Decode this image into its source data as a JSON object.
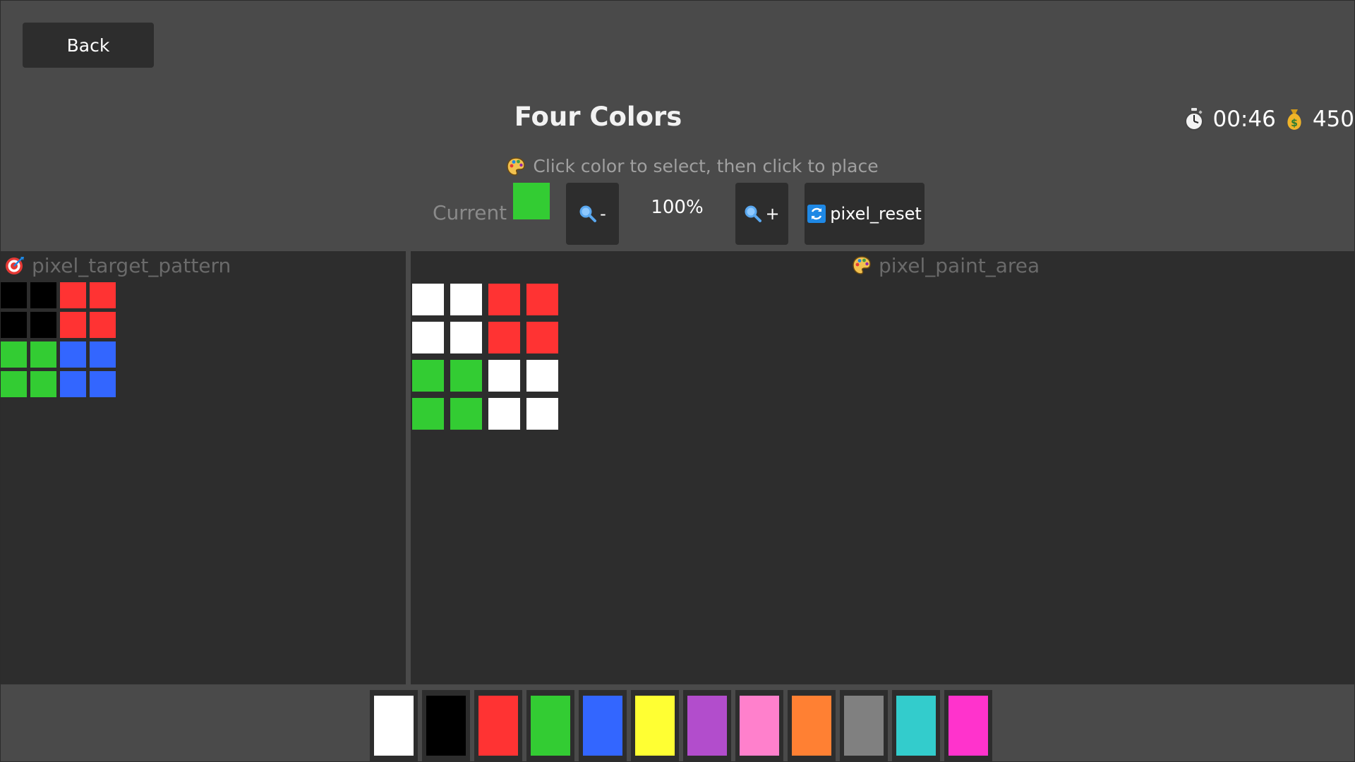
{
  "header": {
    "back_label": "Back",
    "title": "Four Colors",
    "timer": "00:46",
    "coins": "450"
  },
  "hint": "Click color to select, then click to place",
  "toolbar": {
    "current_label": "Current",
    "current_color": "#33cc33",
    "zoom_out_label": "-",
    "zoom_level": "100%",
    "zoom_in_label": "+",
    "reset_label": "pixel_reset"
  },
  "target_panel": {
    "label": "pixel_target_pattern",
    "cells": [
      "#000000",
      "#000000",
      "#ff3333",
      "#ff3333",
      "#000000",
      "#000000",
      "#ff3333",
      "#ff3333",
      "#33cc33",
      "#33cc33",
      "#3366ff",
      "#3366ff",
      "#33cc33",
      "#33cc33",
      "#3366ff",
      "#3366ff"
    ]
  },
  "paint_panel": {
    "label": "pixel_paint_area",
    "cells": [
      "#ffffff",
      "#ffffff",
      "#ff3333",
      "#ff3333",
      "#ffffff",
      "#ffffff",
      "#ff3333",
      "#ff3333",
      "#33cc33",
      "#33cc33",
      "#ffffff",
      "#ffffff",
      "#33cc33",
      "#33cc33",
      "#ffffff",
      "#ffffff"
    ]
  },
  "palette": [
    {
      "name": "white",
      "color": "#ffffff"
    },
    {
      "name": "black",
      "color": "#000000"
    },
    {
      "name": "red",
      "color": "#ff3333"
    },
    {
      "name": "green",
      "color": "#33cc33"
    },
    {
      "name": "blue",
      "color": "#3366ff"
    },
    {
      "name": "yellow",
      "color": "#ffff33"
    },
    {
      "name": "purple",
      "color": "#b24dcc"
    },
    {
      "name": "pink",
      "color": "#ff80cc"
    },
    {
      "name": "orange",
      "color": "#ff8033"
    },
    {
      "name": "gray",
      "color": "#808080"
    },
    {
      "name": "cyan",
      "color": "#33cccc"
    },
    {
      "name": "magenta",
      "color": "#ff33cc"
    }
  ],
  "icons": {
    "timer": "stopwatch-icon",
    "coins": "money-bag-icon",
    "hint": "palette-icon",
    "target": "target-icon",
    "paint": "palette-icon",
    "zoom": "magnifier-icon",
    "reset": "refresh-icon"
  }
}
